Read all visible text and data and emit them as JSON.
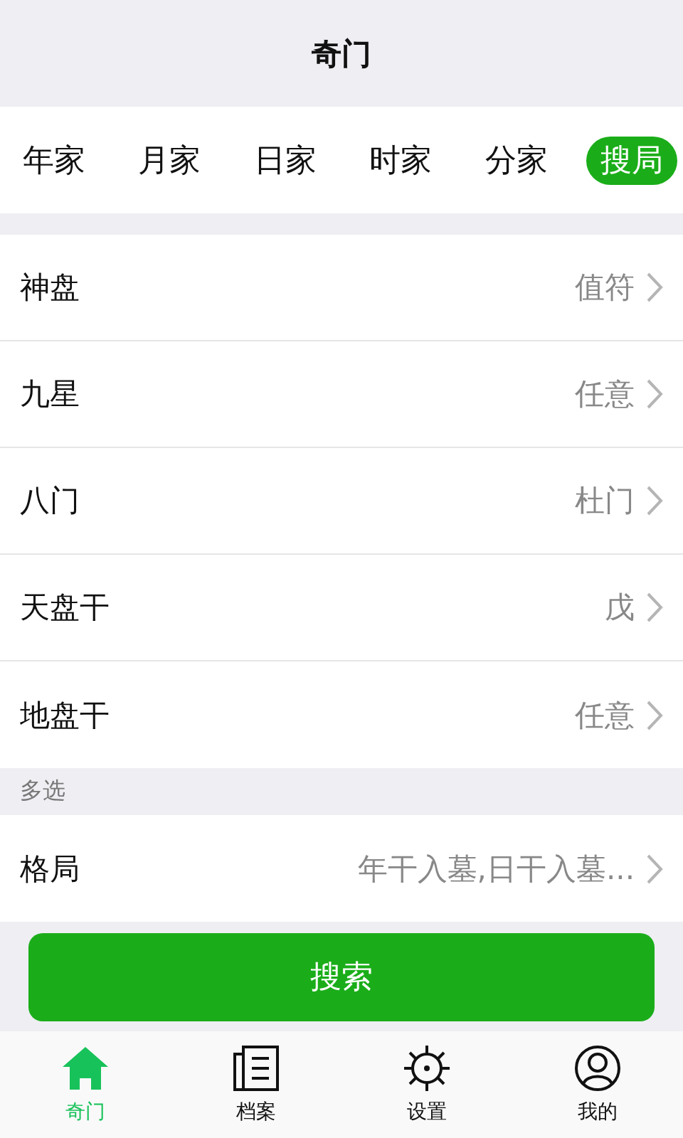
{
  "header": {
    "title": "奇门"
  },
  "tabs": [
    {
      "label": "年家",
      "selected": false
    },
    {
      "label": "月家",
      "selected": false
    },
    {
      "label": "日家",
      "selected": false
    },
    {
      "label": "时家",
      "selected": false
    },
    {
      "label": "分家",
      "selected": false
    },
    {
      "label": "搜局",
      "selected": true
    }
  ],
  "settings": [
    {
      "label": "神盘",
      "value": "值符"
    },
    {
      "label": "九星",
      "value": "任意"
    },
    {
      "label": "八门",
      "value": "杜门"
    },
    {
      "label": "天盘干",
      "value": "戊"
    },
    {
      "label": "地盘干",
      "value": "任意"
    }
  ],
  "multi_select": {
    "title": "多选",
    "rows": [
      {
        "label": "格局",
        "value": "年干入墓,日干入墓..."
      }
    ]
  },
  "search_button": "搜索",
  "nav": [
    {
      "kind": "home",
      "label": "奇门",
      "selected": true
    },
    {
      "kind": "archive",
      "label": "档案",
      "selected": false
    },
    {
      "kind": "settings",
      "label": "设置",
      "selected": false
    },
    {
      "kind": "profile",
      "label": "我的",
      "selected": false
    }
  ]
}
